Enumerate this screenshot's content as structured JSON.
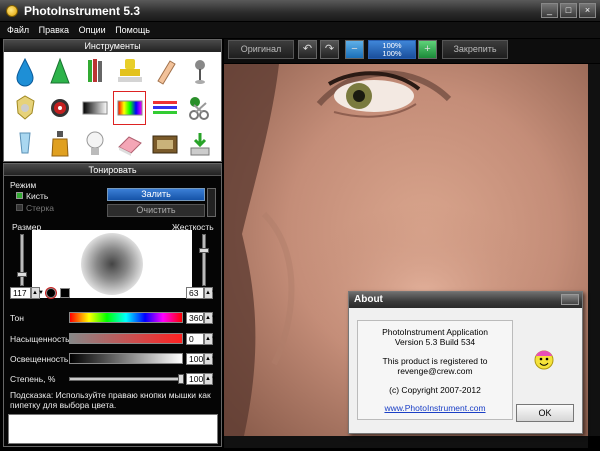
{
  "window": {
    "title": "PhotoInstrument 5.3",
    "controls": [
      "_",
      "□",
      "×"
    ]
  },
  "menu": [
    "Файл",
    "Правка",
    "Опции",
    "Помощь"
  ],
  "tools_panel": {
    "header": "Инструменты",
    "tool_icons": [
      "drop-icon",
      "cone-icon",
      "pencils-icon",
      "stamp-icon",
      "tube-icon",
      "pin-icon",
      "wand-icon",
      "eye-icon",
      "gradient-icon",
      "rainbow-icon",
      "lines-icon",
      "scissors-icon",
      "glass-icon",
      "bottle-icon",
      "bulb-icon",
      "eraser-icon",
      "film-icon",
      "save-icon"
    ],
    "selected_index": 9
  },
  "tone_panel": {
    "header": "Тонировать",
    "mode_label": "Режим",
    "mode_brush": "Кисть",
    "mode_eraser": "Стерка",
    "fill_button": "Залить",
    "clear_button": "Очистить",
    "size_label": "Размер",
    "hardness_label": "Жесткость",
    "size_value": "117",
    "hardness_value": "63",
    "hue_label": "Тон",
    "hue_value": "360",
    "saturation_label": "Насыщенность",
    "saturation_value": "0",
    "lightness_label": "Освещенность",
    "lightness_value": "100",
    "degree_label": "Степень, %",
    "degree_value": "100",
    "hint": "Подсказка: Используйте праваю кнопки мышки как пипетку для выбора цвета."
  },
  "toolbar": {
    "original_button": "Оригинал",
    "zoom_top": "100%",
    "zoom_bottom": "100%",
    "apply_button": "Закрепить"
  },
  "about": {
    "title": "About",
    "line1": "PhotoInstrument Application",
    "line2": "Version 5.3 Build 534",
    "line3": "This product is registered to",
    "line4": "revenge@crew.com",
    "line5": "(c) Copyright 2007-2012",
    "link": "www.PhotoInstrument.com",
    "ok_button": "OK"
  }
}
